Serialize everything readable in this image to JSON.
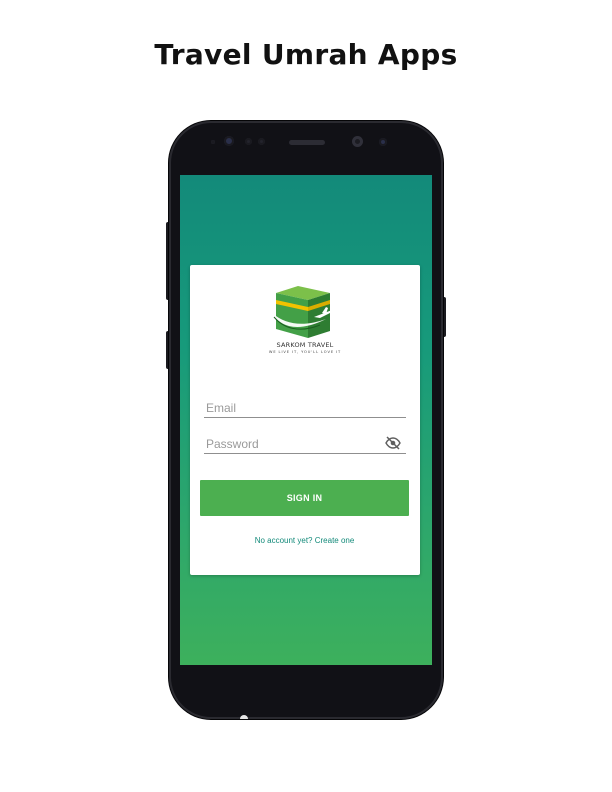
{
  "page": {
    "title": "Travel Umrah Apps"
  },
  "login_card": {
    "brand_name": "SARKOM TRAVEL",
    "brand_tagline": "WE LIVE IT, YOU'LL LOVE IT",
    "email": {
      "placeholder": "Email",
      "value": ""
    },
    "password": {
      "placeholder": "Password",
      "value": "",
      "toggle_icon": "eye-off-icon"
    },
    "sign_in_label": "SIGN IN",
    "create_account_label": "No account yet? Create one"
  },
  "colors": {
    "gradient_top": "#138a7a",
    "gradient_bottom": "#3db05c",
    "button": "#4caf50",
    "link": "#138a7a",
    "phone_body": "#111116",
    "logo_green_dark": "#2e7d32",
    "logo_green_light": "#4caf50",
    "logo_gold": "#f2c200"
  }
}
